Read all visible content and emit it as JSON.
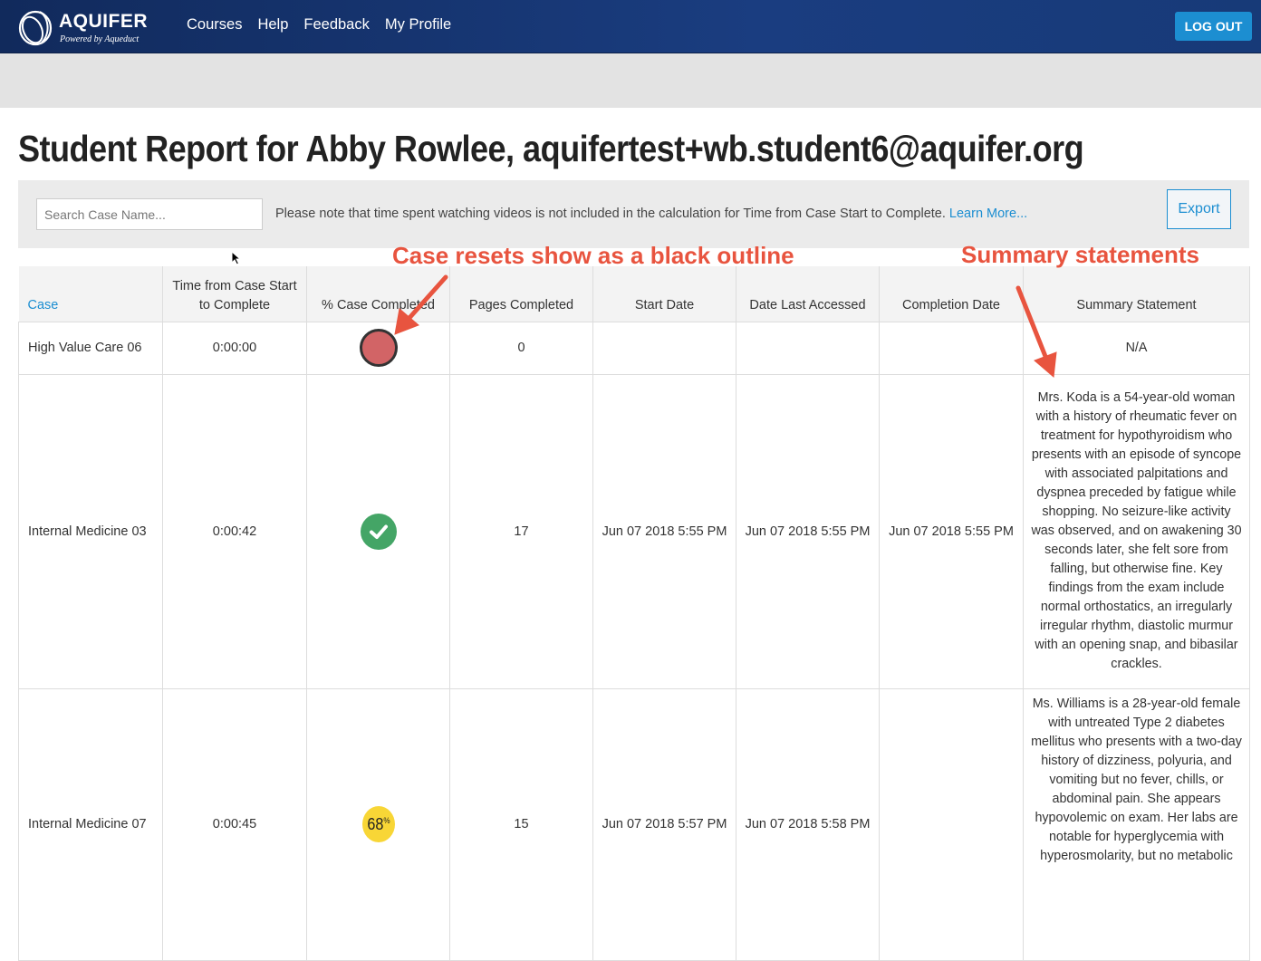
{
  "nav": {
    "logo_title": "AQUIFER",
    "logo_subtitle": "Powered by Aqueduct",
    "links": [
      "Courses",
      "Help",
      "Feedback",
      "My Profile"
    ],
    "logout_label": "LOG OUT"
  },
  "page_title": "Student Report for Abby Rowlee, aquifertest+wb.student6@aquifer.org",
  "toolbar": {
    "search_placeholder": "Search Case Name...",
    "notice": "Please note that time spent watching videos is not included in the calculation for Time from Case Start to Complete. ",
    "learn_more": "Learn More...",
    "export_label": "Export"
  },
  "table": {
    "headers": {
      "case": "Case",
      "time": "Time from Case Start to Complete",
      "pct": "% Case Completed",
      "pages": "Pages Completed",
      "start": "Start Date",
      "accessed": "Date Last Accessed",
      "completion": "Completion Date",
      "summary": "Summary Statement"
    },
    "rows": [
      {
        "case": "High Value Care 06",
        "time": "0:00:00",
        "status": "reset",
        "pages": "0",
        "start": "",
        "accessed": "",
        "completion": "",
        "summary": "N/A"
      },
      {
        "case": "Internal Medicine 03",
        "time": "0:00:42",
        "status": "complete",
        "pages": "17",
        "start": "Jun 07 2018 5:55 PM",
        "accessed": "Jun 07 2018 5:55 PM",
        "completion": "Jun 07 2018 5:55 PM",
        "summary": "Mrs. Koda is a 54-year-old woman with a history of rheumatic fever on treatment for hypothyroidism who presents with an episode of syncope with associated palpitations and dyspnea preceded by fatigue while shopping. No seizure-like activity was observed, and on awakening 30 seconds later, she felt sore from falling, but otherwise fine. Key findings from the exam include normal orthostatics, an irregularly irregular rhythm, diastolic murmur with an opening snap, and bibasilar crackles."
      },
      {
        "case": "Internal Medicine 07",
        "time": "0:00:45",
        "status": "partial",
        "pct_value": "68",
        "pct_sign": "%",
        "pages": "15",
        "start": "Jun 07 2018 5:57 PM",
        "accessed": "Jun 07 2018 5:58 PM",
        "completion": "",
        "summary": "Ms. Williams is a 28-year-old female with untreated Type 2 diabetes mellitus who presents with a two-day history of dizziness, polyuria, and vomiting but no fever, chills, or abdominal pain. She appears hypovolemic on exam. Her labs are notable for hyperglycemia with hyperosmolarity, but no metabolic"
      }
    ]
  },
  "annotations": {
    "left": "Case resets show as a black outline",
    "right": "Summary statements",
    "color": "#e8543f"
  },
  "colors": {
    "navbar": "#173a78",
    "accent": "#1c8ed1",
    "reset_dot": "#d26466",
    "complete_dot": "#44a566",
    "partial_dot": "#f8d636"
  }
}
